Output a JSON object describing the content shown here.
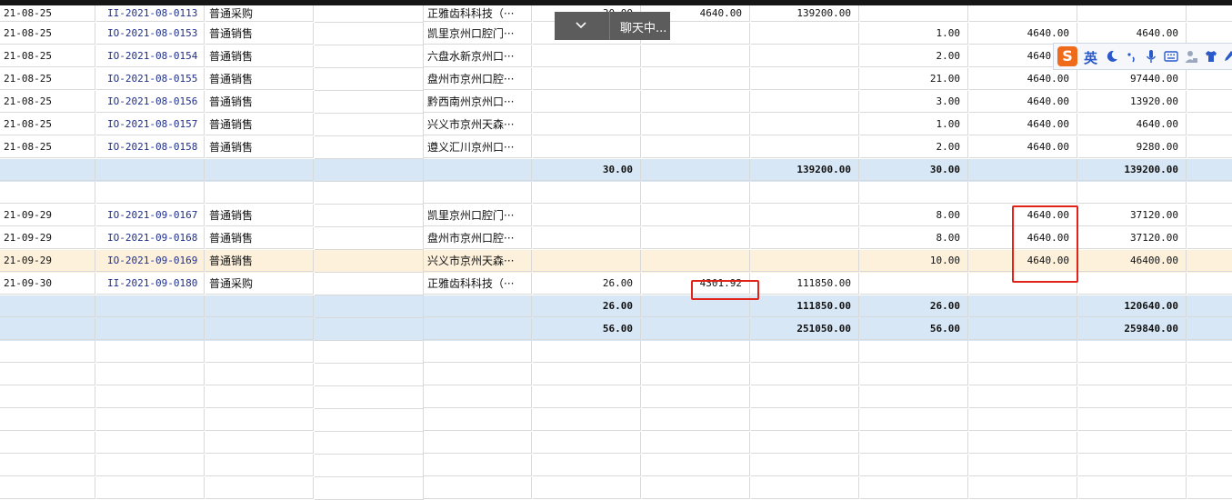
{
  "chat_popup": {
    "label": "聊天中..."
  },
  "ime_toolbar": {
    "logo": "S",
    "language": "英"
  },
  "rows": [
    {
      "kind": "data",
      "date": "21-08-25",
      "doc": "II-2021-08-0113",
      "type": "普通采购",
      "party": "正雅齿科科技（···",
      "c1": "30.00",
      "c2": "4640.00",
      "c3": "139200.00",
      "c4": "",
      "c5": "",
      "c6": "",
      "first": true
    },
    {
      "kind": "data",
      "date": "21-08-25",
      "doc": "IO-2021-08-0153",
      "type": "普通销售",
      "party": "凯里京州口腔门···",
      "c1": "",
      "c2": "",
      "c3": "",
      "c4": "1.00",
      "c5": "4640.00",
      "c6": "4640.00"
    },
    {
      "kind": "data",
      "date": "21-08-25",
      "doc": "IO-2021-08-0154",
      "type": "普通销售",
      "party": "六盘水新京州口···",
      "c1": "",
      "c2": "",
      "c3": "",
      "c4": "2.00",
      "c5": "4640.00",
      "c6": ""
    },
    {
      "kind": "data",
      "date": "21-08-25",
      "doc": "IO-2021-08-0155",
      "type": "普通销售",
      "party": "盘州市京州口腔···",
      "c1": "",
      "c2": "",
      "c3": "",
      "c4": "21.00",
      "c5": "4640.00",
      "c6": "97440.00"
    },
    {
      "kind": "data",
      "date": "21-08-25",
      "doc": "IO-2021-08-0156",
      "type": "普通销售",
      "party": "黔西南州京州口···",
      "c1": "",
      "c2": "",
      "c3": "",
      "c4": "3.00",
      "c5": "4640.00",
      "c6": "13920.00"
    },
    {
      "kind": "data",
      "date": "21-08-25",
      "doc": "IO-2021-08-0157",
      "type": "普通销售",
      "party": "兴义市京州天森···",
      "c1": "",
      "c2": "",
      "c3": "",
      "c4": "1.00",
      "c5": "4640.00",
      "c6": "4640.00"
    },
    {
      "kind": "data",
      "date": "21-08-25",
      "doc": "IO-2021-08-0158",
      "type": "普通销售",
      "party": "遵义汇川京州口···",
      "c1": "",
      "c2": "",
      "c3": "",
      "c4": "2.00",
      "c5": "4640.00",
      "c6": "9280.00"
    },
    {
      "kind": "total",
      "c1": "30.00",
      "c2": "",
      "c3": "139200.00",
      "c4": "30.00",
      "c5": "",
      "c6": "139200.00"
    },
    {
      "kind": "empty"
    },
    {
      "kind": "data",
      "date": "21-09-29",
      "doc": "IO-2021-09-0167",
      "type": "普通销售",
      "party": "凯里京州口腔门···",
      "c1": "",
      "c2": "",
      "c3": "",
      "c4": "8.00",
      "c5": "4640.00",
      "c6": "37120.00"
    },
    {
      "kind": "data",
      "date": "21-09-29",
      "doc": "IO-2021-09-0168",
      "type": "普通销售",
      "party": "盘州市京州口腔···",
      "c1": "",
      "c2": "",
      "c3": "",
      "c4": "8.00",
      "c5": "4640.00",
      "c6": "37120.00"
    },
    {
      "kind": "data",
      "date": "21-09-29",
      "doc": "IO-2021-09-0169",
      "type": "普通销售",
      "party": "兴义市京州天森···",
      "c1": "",
      "c2": "",
      "c3": "",
      "c4": "10.00",
      "c5": "4640.00",
      "c6": "46400.00",
      "selected": true
    },
    {
      "kind": "data",
      "date": "21-09-30",
      "doc": "II-2021-09-0180",
      "type": "普通采购",
      "party": "正雅齿科科技（···",
      "c1": "26.00",
      "c2": "4301.92",
      "c3": "111850.00",
      "c4": "",
      "c5": "",
      "c6": ""
    },
    {
      "kind": "total",
      "c1": "26.00",
      "c2": "",
      "c3": "111850.00",
      "c4": "26.00",
      "c5": "",
      "c6": "120640.00"
    },
    {
      "kind": "total",
      "c1": "56.00",
      "c2": "",
      "c3": "251050.00",
      "c4": "56.00",
      "c5": "",
      "c6": "259840.00"
    },
    {
      "kind": "empty"
    },
    {
      "kind": "empty"
    },
    {
      "kind": "empty"
    },
    {
      "kind": "empty"
    },
    {
      "kind": "empty"
    },
    {
      "kind": "empty"
    },
    {
      "kind": "empty"
    }
  ]
}
